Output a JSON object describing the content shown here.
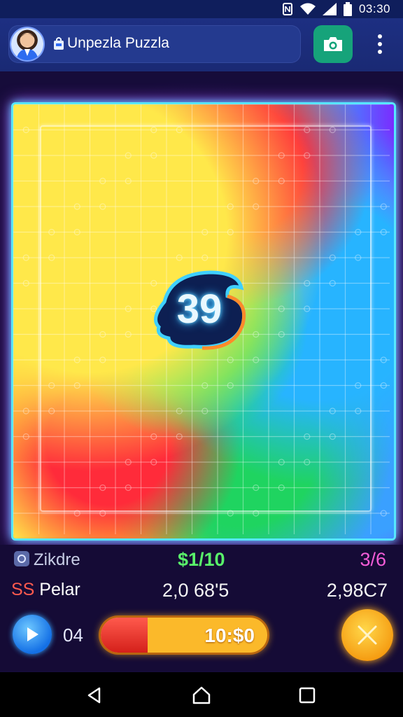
{
  "status_bar": {
    "time": "03:30"
  },
  "app_bar": {
    "title": "Unpezla Puzzla"
  },
  "board": {
    "center_number": "39"
  },
  "stats": {
    "row1": {
      "label": "Zikdre",
      "middle": "$1/10",
      "right": "3/6"
    },
    "row2": {
      "label_prefix": "SS",
      "label_suffix": " Pelar",
      "middle": "2,0 68'5",
      "right": "2,98C7"
    }
  },
  "controls": {
    "level": "04",
    "progress_label": "10:$0",
    "progress_fraction": 0.28
  },
  "colors": {
    "accent_cyan": "#57e6ff",
    "accent_purple": "#b14dff",
    "camera_green": "#16a37a",
    "progress_orange": "#fbb92a",
    "progress_red": "#d4201b"
  },
  "icons": [
    "nfc-icon",
    "wifi-icon",
    "signal-icon",
    "battery-icon",
    "avatar",
    "bag-icon",
    "camera-icon",
    "more-vert-icon",
    "play-icon",
    "close-icon",
    "back-icon",
    "home-icon",
    "recents-icon"
  ]
}
